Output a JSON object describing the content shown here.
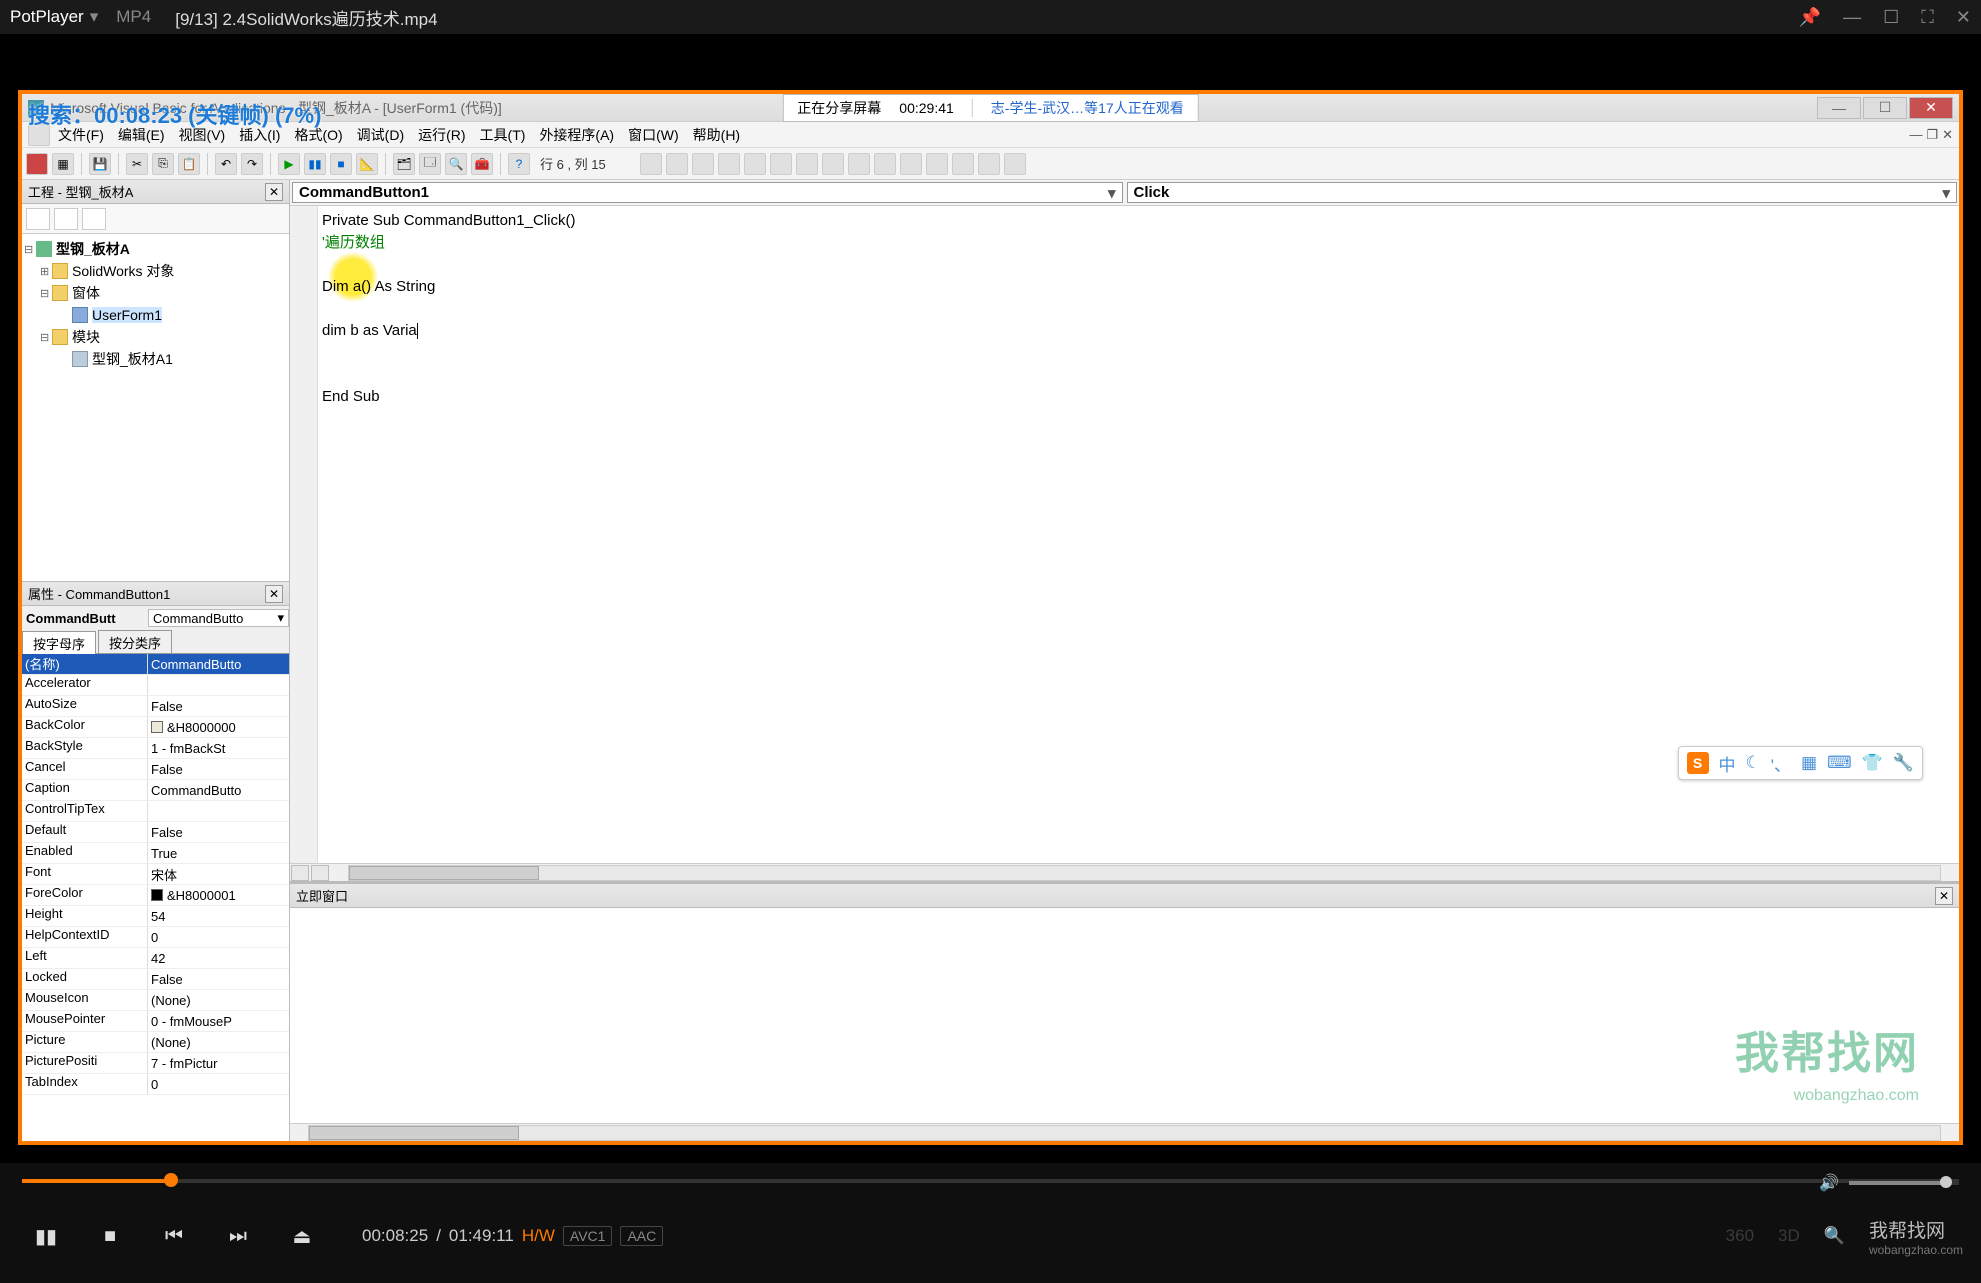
{
  "potplayer": {
    "app_name": "PotPlayer",
    "format": "MP4",
    "title": "[9/13] 2.4SolidWorks遍历技术.mp4",
    "current_time": "00:08:25",
    "total_time": "01:49:11",
    "hw": "H/W",
    "codec_v": "AVC1",
    "codec_a": "AAC",
    "right_labels": {
      "l360": "360",
      "l3d": "3D"
    },
    "brand": "我帮找网",
    "brand_url": "wobangzhao.com",
    "search_overlay": "搜索：00:08:23 (关键帧) (7%)"
  },
  "share": {
    "left": "正在分享屏幕",
    "time": "00:29:41",
    "right": "志-学生-武汉…等17人正在观看"
  },
  "vbe": {
    "title": "Microsoft Visual Basic for Applications - 型钢_板材A - [UserForm1 (代码)]",
    "menus": [
      "文件(F)",
      "编辑(E)",
      "视图(V)",
      "插入(I)",
      "格式(O)",
      "调试(D)",
      "运行(R)",
      "工具(T)",
      "外接程序(A)",
      "窗口(W)",
      "帮助(H)"
    ],
    "status": "行 6 , 列 15",
    "project_pane_title": "工程 - 型钢_板材A",
    "tree": {
      "root": "型钢_板材A",
      "folders": [
        {
          "name": "SolidWorks 对象",
          "children": []
        },
        {
          "name": "窗体",
          "children": [
            "UserForm1"
          ]
        },
        {
          "name": "模块",
          "children": [
            "型钢_板材A1"
          ]
        }
      ]
    },
    "props_title": "属性 - CommandButton1",
    "props_obj_name": "CommandButt",
    "props_obj_type": "CommandButto",
    "tabs": {
      "alpha": "按字母序",
      "cat": "按分类序"
    },
    "props": [
      {
        "k": "(名称)",
        "v": "CommandButto",
        "sel": true
      },
      {
        "k": "Accelerator",
        "v": ""
      },
      {
        "k": "AutoSize",
        "v": "False"
      },
      {
        "k": "BackColor",
        "v": "&H8000000",
        "swatch": "#ece9d8"
      },
      {
        "k": "BackStyle",
        "v": "1 - fmBackSt"
      },
      {
        "k": "Cancel",
        "v": "False"
      },
      {
        "k": "Caption",
        "v": "CommandButto"
      },
      {
        "k": "ControlTipTex",
        "v": ""
      },
      {
        "k": "Default",
        "v": "False"
      },
      {
        "k": "Enabled",
        "v": "True"
      },
      {
        "k": "Font",
        "v": "宋体"
      },
      {
        "k": "ForeColor",
        "v": "&H8000001",
        "swatch": "#000000"
      },
      {
        "k": "Height",
        "v": "54"
      },
      {
        "k": "HelpContextID",
        "v": "0"
      },
      {
        "k": "Left",
        "v": "42"
      },
      {
        "k": "Locked",
        "v": "False"
      },
      {
        "k": "MouseIcon",
        "v": "(None)"
      },
      {
        "k": "MousePointer",
        "v": "0 - fmMouseP"
      },
      {
        "k": "Picture",
        "v": "(None)"
      },
      {
        "k": "PicturePositi",
        "v": "7 - fmPictur"
      },
      {
        "k": "TabIndex",
        "v": "0"
      }
    ],
    "code_left_dd": "CommandButton1",
    "code_right_dd": "Click",
    "code": {
      "l1": "Private Sub CommandButton1_Click()",
      "l2": "'遍历数组",
      "l3": "",
      "l4": "Dim a() As String",
      "l5": "",
      "l6": "dim b as Varia",
      "l7": "",
      "l8": "",
      "l9": "End Sub"
    },
    "immediate_title": "立即窗口"
  },
  "ime": {
    "items": [
      "中",
      "☾",
      "'、",
      "▦",
      "⌨",
      "👕",
      "🔧"
    ]
  },
  "watermark": {
    "text": "我帮找网",
    "url": "wobangzhao.com"
  }
}
